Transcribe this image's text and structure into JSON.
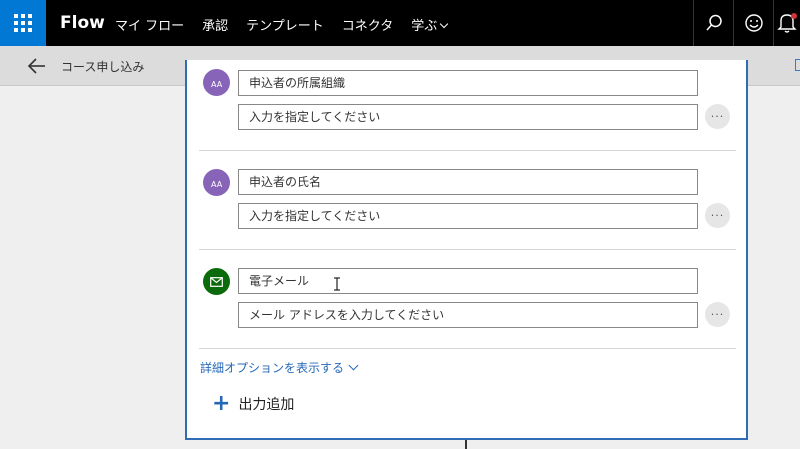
{
  "topbar": {
    "brand": "Flow",
    "nav": [
      {
        "label": "マイ フロー"
      },
      {
        "label": "承認"
      },
      {
        "label": "テンプレート"
      },
      {
        "label": "コネクタ"
      },
      {
        "label": "学ぶ",
        "has_dropdown": true
      }
    ],
    "icons": [
      "waffle-icon",
      "search-icon",
      "smiley-icon",
      "bell-icon"
    ],
    "colors": {
      "bar": "#000000",
      "waffle": "#0078d4"
    }
  },
  "subheader": {
    "flow_name": "コース申し込み",
    "icons": [
      "back-arrow-icon"
    ]
  },
  "card": {
    "fields": [
      {
        "icon": "text-input-icon",
        "name": "申込者の所属組織",
        "value_placeholder": "入力を指定してください"
      },
      {
        "icon": "text-input-icon",
        "name": "申込者の氏名",
        "value_placeholder": "入力を指定してください"
      },
      {
        "icon": "mail-icon",
        "name": "電子メール",
        "value_placeholder": "メール アドレスを入力してください"
      }
    ],
    "ellipsis": "···",
    "advanced_link": "詳細オプションを表示する",
    "add_output": "出力追加",
    "colors": {
      "accent": "#2f6cb3",
      "text_avatar": "#8764b8",
      "mail_avatar": "#0b6a0b"
    }
  }
}
